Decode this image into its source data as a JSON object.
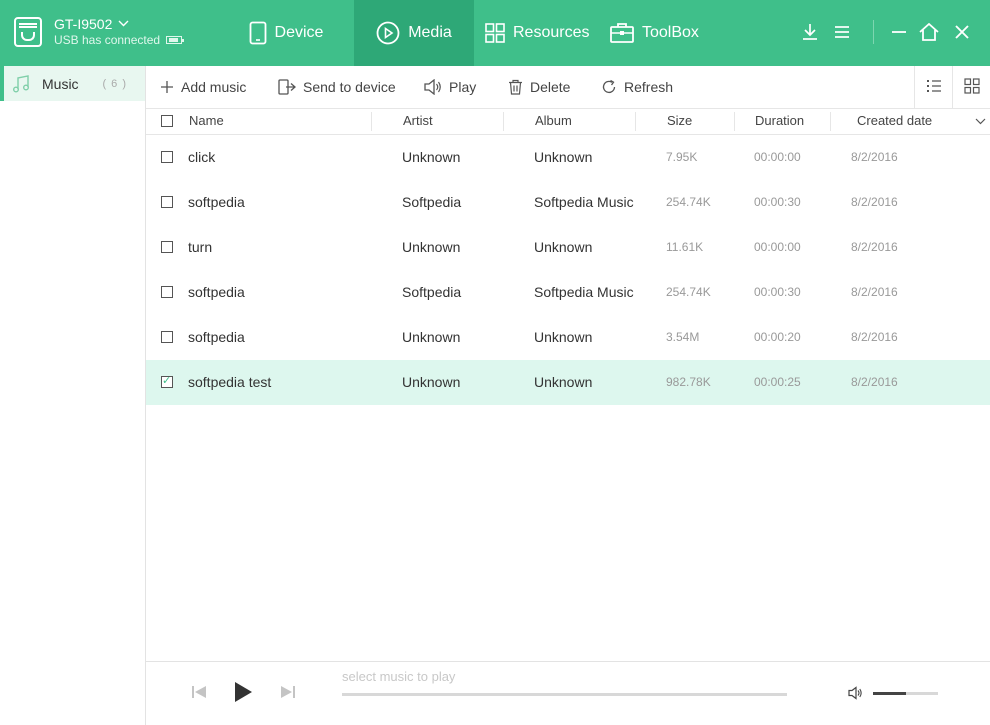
{
  "app": {
    "device_name": "GT-I9502",
    "device_status": "USB has connected"
  },
  "nav": {
    "tabs": [
      {
        "label": "Device",
        "icon": "phone-icon"
      },
      {
        "label": "Media",
        "icon": "play-circle-icon",
        "active": true
      },
      {
        "label": "Resources",
        "icon": "grid-icon"
      },
      {
        "label": "ToolBox",
        "icon": "toolbox-icon"
      }
    ]
  },
  "sidebar": {
    "items": [
      {
        "label": "Music",
        "count": "( 6 )",
        "icon": "music-note-icon"
      }
    ]
  },
  "toolbar": {
    "add_label": "Add music",
    "send_label": "Send to device",
    "play_label": "Play",
    "delete_label": "Delete",
    "refresh_label": "Refresh"
  },
  "table": {
    "headers": {
      "name": "Name",
      "artist": "Artist",
      "album": "Album",
      "size": "Size",
      "duration": "Duration",
      "created": "Created date"
    },
    "rows": [
      {
        "name": "click",
        "artist": "Unknown",
        "album": "Unknown",
        "size": "7.95K",
        "duration": "00:00:00",
        "created": "8/2/2016",
        "checked": false
      },
      {
        "name": "softpedia",
        "artist": "Softpedia",
        "album": "Softpedia Music",
        "size": "254.74K",
        "duration": "00:00:30",
        "created": "8/2/2016",
        "checked": false
      },
      {
        "name": "turn",
        "artist": "Unknown",
        "album": "Unknown",
        "size": "11.61K",
        "duration": "00:00:00",
        "created": "8/2/2016",
        "checked": false
      },
      {
        "name": "softpedia",
        "artist": "Softpedia",
        "album": "Softpedia Music",
        "size": "254.74K",
        "duration": "00:00:30",
        "created": "8/2/2016",
        "checked": false
      },
      {
        "name": "softpedia",
        "artist": "Unknown",
        "album": "Unknown",
        "size": "3.54M",
        "duration": "00:00:20",
        "created": "8/2/2016",
        "checked": false
      },
      {
        "name": "softpedia test",
        "artist": "Unknown",
        "album": "Unknown",
        "size": "982.78K",
        "duration": "00:00:25",
        "created": "8/2/2016",
        "checked": true
      }
    ]
  },
  "player": {
    "now_playing": "select music to play",
    "volume_fraction": 0.5
  },
  "colors": {
    "accent": "#3fbf8a",
    "accent_dark": "#2ea877",
    "selected_row": "#ddf7ee"
  }
}
